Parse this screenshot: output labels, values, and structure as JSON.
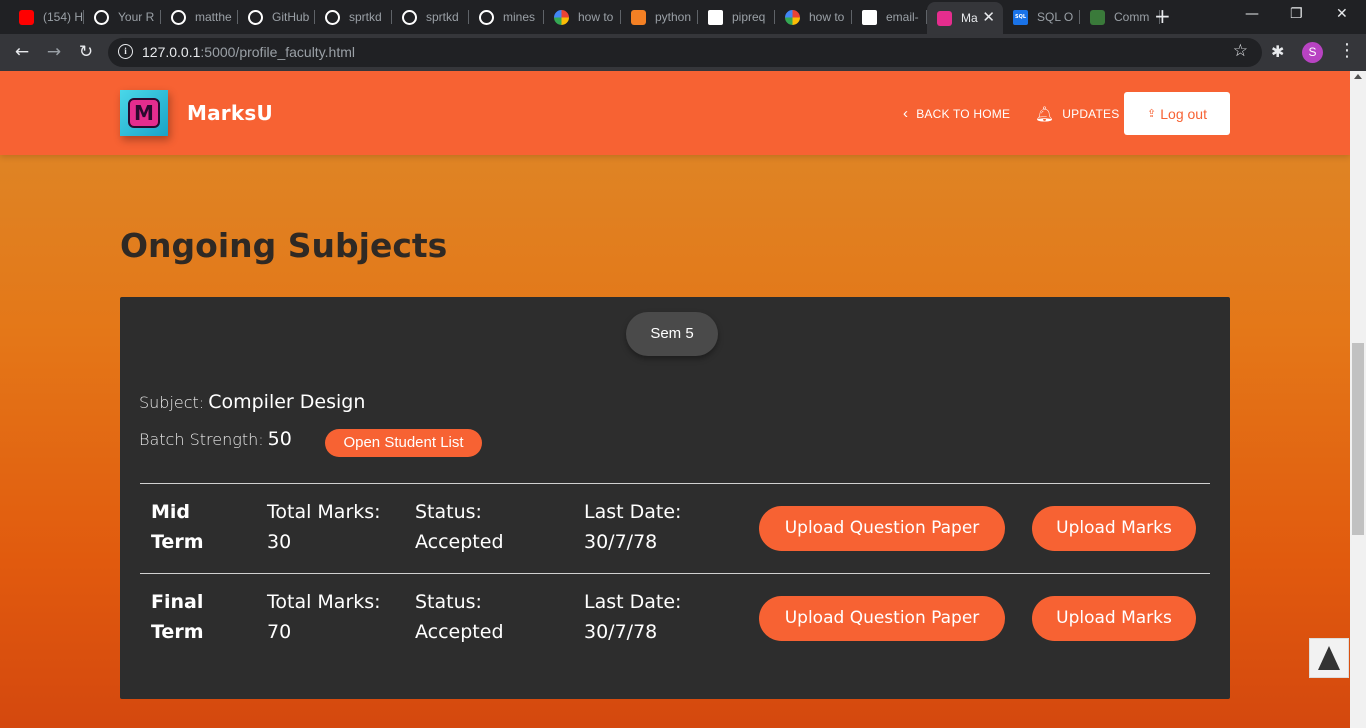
{
  "browser": {
    "tabs": [
      {
        "label": "(154) H",
        "icon": "youtube-icon",
        "color": "#ff0000"
      },
      {
        "label": "Your R",
        "icon": "github-icon",
        "color": "#ffffff"
      },
      {
        "label": "matthe",
        "icon": "github-icon",
        "color": "#ffffff"
      },
      {
        "label": "GitHub",
        "icon": "github-icon",
        "color": "#ffffff"
      },
      {
        "label": "sprtkd",
        "icon": "github-icon",
        "color": "#ffffff"
      },
      {
        "label": "sprtkd",
        "icon": "github-icon",
        "color": "#ffffff"
      },
      {
        "label": "mines",
        "icon": "github-icon",
        "color": "#ffffff"
      },
      {
        "label": "how to",
        "icon": "google-icon",
        "color": "#4285f4"
      },
      {
        "label": "python",
        "icon": "stackoverflow-icon",
        "color": "#f48024"
      },
      {
        "label": "pipreq",
        "icon": "cube-icon",
        "color": "#ffffff"
      },
      {
        "label": "how to",
        "icon": "google-icon",
        "color": "#4285f4"
      },
      {
        "label": "email-",
        "icon": "cube-icon",
        "color": "#ffffff"
      },
      {
        "label": "Ma",
        "icon": "marksu-icon",
        "color": "#e52d8e",
        "active": true
      },
      {
        "label": "SQL O",
        "icon": "sql-icon",
        "color": "#1a73e8"
      },
      {
        "label": "Comm",
        "icon": "sql-tile-icon",
        "color": "#3a7a3a"
      }
    ],
    "sql_badge": "SQL",
    "url_host": "127.0.0.1",
    "url_rest": ":5000/profile_faculty.html",
    "profile_initial": "S"
  },
  "header": {
    "brand": "MarksU",
    "logo_letter": "M",
    "back_home": "BACK TO HOME",
    "updates": "UPDATES",
    "logout": "Log out"
  },
  "section_title": "Ongoing Subjects",
  "card": {
    "semester": "Sem 5",
    "subject_label": "Subject:",
    "subject_value": "Compiler Design",
    "batch_label": "Batch Strength:",
    "batch_value": "50",
    "student_list_button": "Open Student List",
    "rows": [
      {
        "name_line1": "Mid",
        "name_line2": "Term",
        "marks_label": "Total Marks:",
        "marks_value": "30",
        "status_label": "Status:",
        "status_value": "Accepted",
        "date_label": "Last Date:",
        "date_value": "30/7/78",
        "upload_qp": "Upload Question Paper",
        "upload_marks": "Upload Marks"
      },
      {
        "name_line1": "Final",
        "name_line2": "Term",
        "marks_label": "Total Marks:",
        "marks_value": "70",
        "status_label": "Status:",
        "status_value": "Accepted",
        "date_label": "Last Date:",
        "date_value": "30/7/78",
        "upload_qp": "Upload Question Paper",
        "upload_marks": "Upload Marks"
      }
    ]
  },
  "colors": {
    "accent": "#f76233",
    "card_bg": "#2d2d2d",
    "title_text": "#2f2924"
  }
}
